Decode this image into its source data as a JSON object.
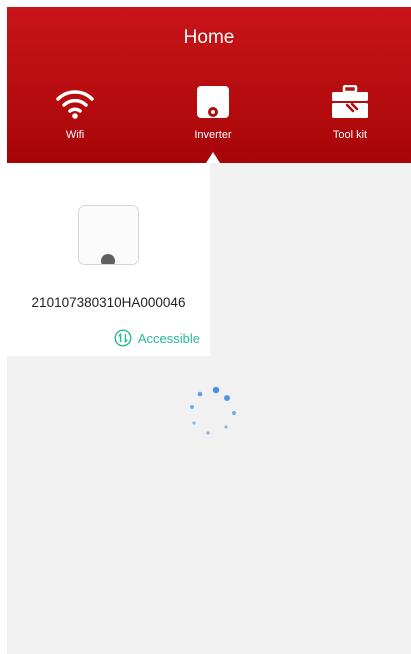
{
  "header": {
    "title": "Home"
  },
  "tabs": [
    {
      "label": "Wifi",
      "icon": "wifi-icon"
    },
    {
      "label": "Inverter",
      "icon": "inverter-icon",
      "selected": true
    },
    {
      "label": "Tool kit",
      "icon": "toolbox-icon"
    }
  ],
  "device": {
    "serial": "210107380310HA000046",
    "status": "Accessible",
    "status_icon": "accessible-icon"
  },
  "loading": {
    "icon": "loading-spinner-icon"
  },
  "colors": {
    "header_red": "#b80d10",
    "status_green": "#2bb99a",
    "spinner_blue": "#4a90e2",
    "background": "#f1f1f1"
  }
}
